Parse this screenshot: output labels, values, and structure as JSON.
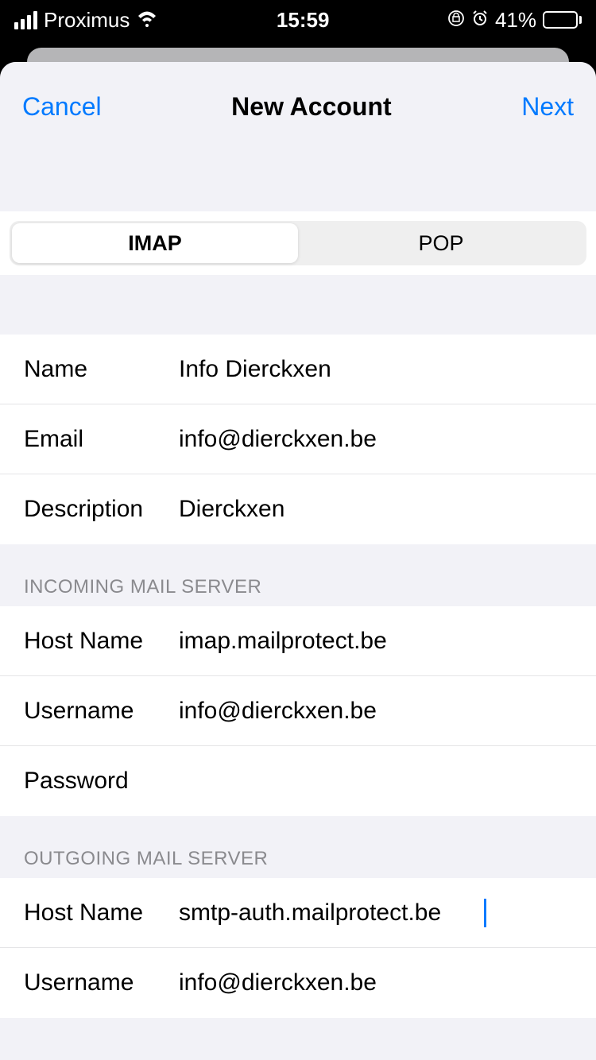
{
  "status": {
    "carrier": "Proximus",
    "time": "15:59",
    "battery": "41%"
  },
  "nav": {
    "cancel": "Cancel",
    "title": "New Account",
    "next": "Next"
  },
  "tabs": {
    "imap": "IMAP",
    "pop": "POP"
  },
  "account": {
    "name_label": "Name",
    "name_value": "Info Dierckxen",
    "email_label": "Email",
    "email_value": "info@dierckxen.be",
    "description_label": "Description",
    "description_value": "Dierckxen"
  },
  "incoming": {
    "header": "INCOMING MAIL SERVER",
    "host_label": "Host Name",
    "host_value": "imap.mailprotect.be",
    "user_label": "Username",
    "user_value": "info@dierckxen.be",
    "pass_label": "Password",
    "pass_value": ""
  },
  "outgoing": {
    "header": "OUTGOING MAIL SERVER",
    "host_label": "Host Name",
    "host_value": "smtp-auth.mailprotect.be",
    "user_label": "Username",
    "user_value": "info@dierckxen.be"
  }
}
